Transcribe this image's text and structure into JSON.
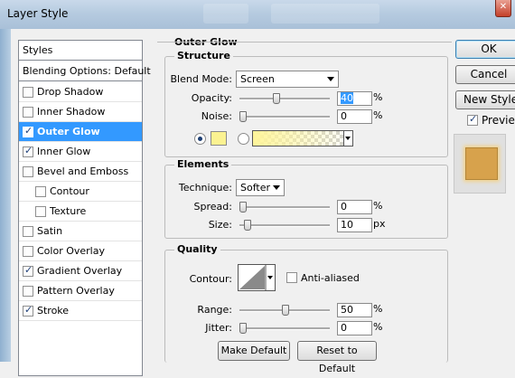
{
  "window": {
    "title": "Layer Style"
  },
  "styles_panel": {
    "header": "Styles",
    "blending": "Blending Options: Default",
    "items": [
      {
        "label": "Drop Shadow",
        "checked": false
      },
      {
        "label": "Inner Shadow",
        "checked": false
      },
      {
        "label": "Outer Glow",
        "checked": true,
        "selected": true
      },
      {
        "label": "Inner Glow",
        "checked": true
      },
      {
        "label": "Bevel and Emboss",
        "checked": false
      },
      {
        "label": "Contour",
        "checked": false,
        "indent": true
      },
      {
        "label": "Texture",
        "checked": false,
        "indent": true
      },
      {
        "label": "Satin",
        "checked": false
      },
      {
        "label": "Color Overlay",
        "checked": false
      },
      {
        "label": "Gradient Overlay",
        "checked": true
      },
      {
        "label": "Pattern Overlay",
        "checked": false
      },
      {
        "label": "Stroke",
        "checked": true
      }
    ]
  },
  "outer_glow": {
    "title": "Outer Glow",
    "structure": {
      "title": "Structure",
      "blend_mode_label": "Blend Mode:",
      "blend_mode_value": "Screen",
      "opacity_label": "Opacity:",
      "opacity_value": "40",
      "noise_label": "Noise:",
      "noise_value": "0",
      "percent": "%",
      "glow_color": "#fbf291"
    },
    "elements": {
      "title": "Elements",
      "technique_label": "Technique:",
      "technique_value": "Softer",
      "spread_label": "Spread:",
      "spread_value": "0",
      "size_label": "Size:",
      "size_value": "10",
      "percent": "%",
      "px": "px"
    },
    "quality": {
      "title": "Quality",
      "contour_label": "Contour:",
      "antialiased_label": "Anti-aliased",
      "range_label": "Range:",
      "range_value": "50",
      "jitter_label": "Jitter:",
      "jitter_value": "0",
      "percent": "%"
    },
    "make_default": "Make Default",
    "reset_default": "Reset to Default"
  },
  "buttons": {
    "ok": "OK",
    "cancel": "Cancel",
    "new_style": "New Style...",
    "preview": "Preview"
  },
  "preview": {
    "checked": true,
    "swatch_color": "#d7a24c"
  }
}
